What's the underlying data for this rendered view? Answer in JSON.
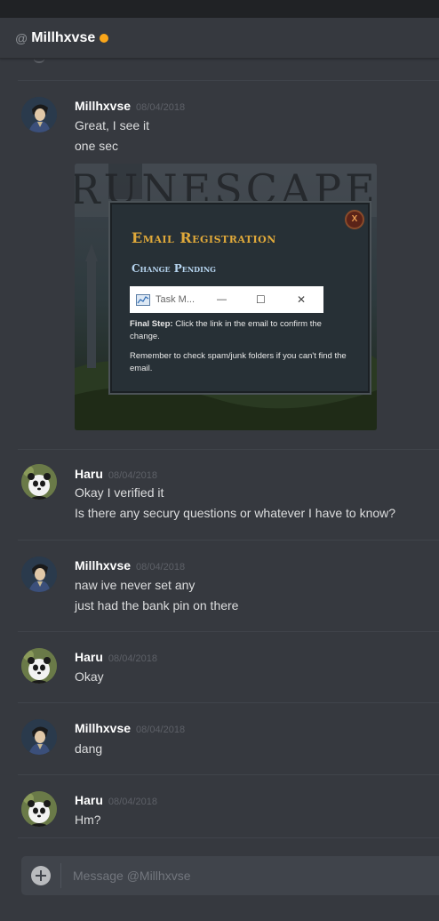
{
  "header": {
    "at_symbol": "@",
    "channel_name": "Millhxvse",
    "status_color": "#faa61a"
  },
  "messages": [
    {
      "author": "Millhxvse",
      "timestamp": "08/04/2018",
      "lines": [
        "Great, I see it",
        "one sec"
      ],
      "attachment": {
        "game_logo": "RUNESCAPE",
        "dialog_title": "Email Registration",
        "dialog_subtitle": "Change Pending",
        "close_glyph": "X",
        "taskbar": {
          "label": "Task M...",
          "minimize": "—",
          "maximize": "☐",
          "close": "✕"
        },
        "final_step_label": "Final Step:",
        "final_step_text": "Click the link in the email to confirm the change.",
        "reminder_text": "Remember to check spam/junk folders if you can't find the email."
      }
    },
    {
      "author": "Haru",
      "timestamp": "08/04/2018",
      "lines": [
        "Okay I verified it",
        "Is there any secury questions or whatever I have to know?"
      ]
    },
    {
      "author": "Millhxvse",
      "timestamp": "08/04/2018",
      "lines": [
        "naw ive never set any",
        "just had the bank pin on there"
      ]
    },
    {
      "author": "Haru",
      "timestamp": "08/04/2018",
      "lines": [
        "Okay"
      ]
    },
    {
      "author": "Millhxvse",
      "timestamp": "08/04/2018",
      "lines": [
        "dang"
      ]
    },
    {
      "author": "Haru",
      "timestamp": "08/04/2018",
      "lines": [
        "Hm?"
      ]
    }
  ],
  "composer": {
    "placeholder": "Message @Millhxvse"
  }
}
